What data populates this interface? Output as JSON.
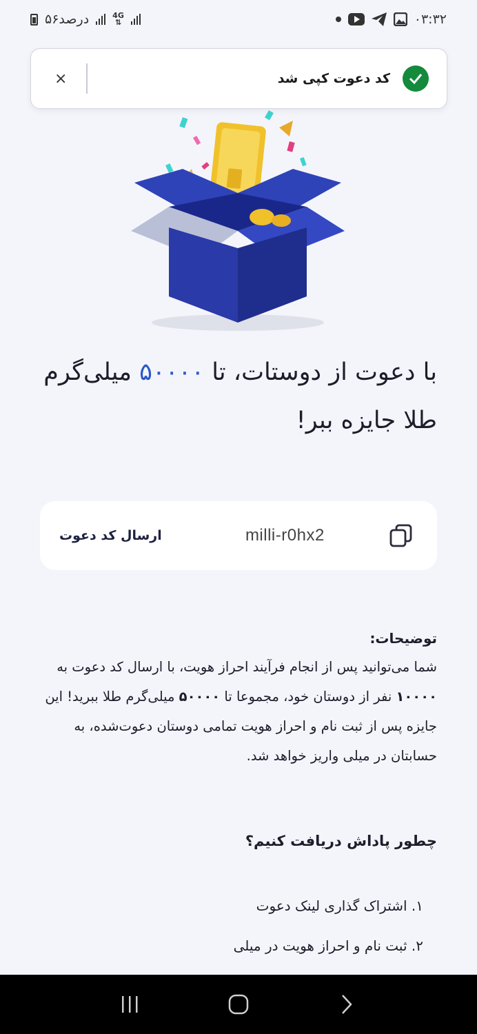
{
  "status_bar": {
    "time": "۰۳:۳۲",
    "battery_text": "۵۶درصد",
    "network": "4G"
  },
  "toast": {
    "message": "کد دعوت کپی شد",
    "close_label": "×"
  },
  "headline": {
    "part1": "با دعوت از دوستات، تا ",
    "amount": "۵۰۰۰۰",
    "part2": " میلی‌گرم طلا جایزه ببر!"
  },
  "invite": {
    "code": "milli-r0hx2",
    "send_label": "ارسال کد دعوت"
  },
  "description": {
    "title": "توضیحات:",
    "body_part1": "شما می‌توانید پس از انجام فرآیند احراز هویت، با ارسال کد دعوت به ",
    "friends_count": "۱۰۰۰۰",
    "body_part2": " نفر از دوستان خود، مجموعا تا ",
    "gold_amount": "۵۰۰۰۰",
    "body_part3": " میلی‌گرم طلا ببرید! این جایزه پس از ثبت نام و احراز هویت تمامی دوستان دعوت‌شده، به حسابتان در میلی واریز خواهد شد."
  },
  "how_to": {
    "title": "چطور پاداش دریافت کنیم؟",
    "steps": [
      "۱. اشتراک گذاری لینک دعوت",
      "۲. ثبت نام و احراز هویت در میلی"
    ]
  },
  "colors": {
    "accent": "#2a58c9",
    "success": "#138a3c",
    "box_blue": "#1f2e8c",
    "gold": "#f0c12a"
  }
}
